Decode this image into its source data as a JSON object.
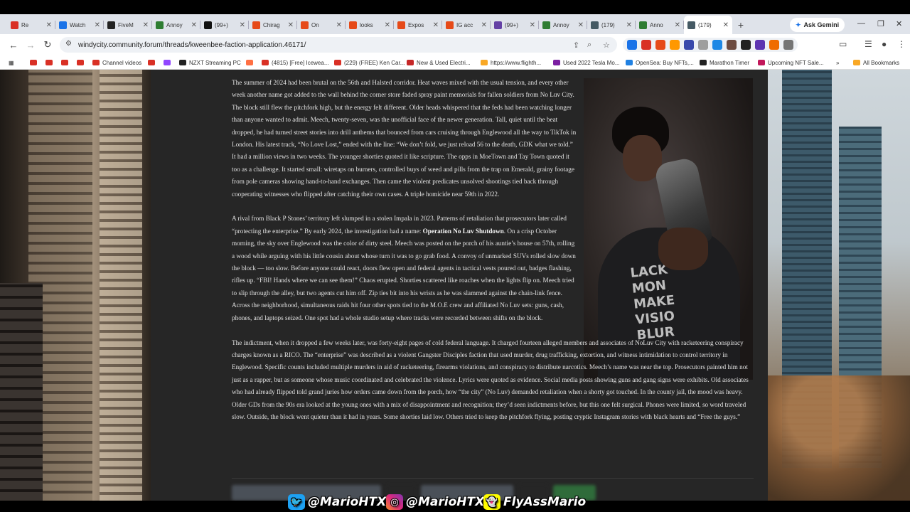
{
  "browser": {
    "tabs": [
      {
        "label": "Re",
        "color": "#d93025",
        "active": false
      },
      {
        "label": "Watch",
        "color": "#1a73e8",
        "active": false
      },
      {
        "label": "FiveM",
        "color": "#222222",
        "active": false
      },
      {
        "label": "Annoy",
        "color": "#2e7d32",
        "active": false
      },
      {
        "label": "(99+)",
        "color": "#111111",
        "active": false
      },
      {
        "label": "Chirag",
        "color": "#e64a19",
        "active": false
      },
      {
        "label": "On",
        "color": "#e64a19",
        "active": false
      },
      {
        "label": "looks",
        "color": "#e64a19",
        "active": false
      },
      {
        "label": "Expos",
        "color": "#e64a19",
        "active": false
      },
      {
        "label": "IG acc",
        "color": "#e64a19",
        "active": false
      },
      {
        "label": "(99+)",
        "color": "#6441a5",
        "active": false
      },
      {
        "label": "Annoy",
        "color": "#2e7d32",
        "active": false
      },
      {
        "label": "(179)",
        "color": "#455a64",
        "active": false
      },
      {
        "label": "Anno",
        "color": "#2e7d32",
        "active": false
      },
      {
        "label": "(179)",
        "color": "#455a64",
        "active": true
      }
    ],
    "new_tab_label": "+",
    "ask_gemini": "Ask Gemini",
    "url": "windycity.community.forum/threads/kweenbee-faction-application.46171/",
    "bookmarks": [
      {
        "label": "",
        "color": "#d93025"
      },
      {
        "label": "",
        "color": "#d93025"
      },
      {
        "label": "",
        "color": "#d93025"
      },
      {
        "label": "",
        "color": "#d93025"
      },
      {
        "label": "Channel videos",
        "color": "#d93025"
      },
      {
        "label": "",
        "color": "#d93025"
      },
      {
        "label": "",
        "color": "#9146ff"
      },
      {
        "label": "NZXT Streaming PC",
        "color": "#222222"
      },
      {
        "label": "",
        "color": "#ff7043"
      },
      {
        "label": "(4815) [Free] Icewea...",
        "color": "#d93025"
      },
      {
        "label": "(229) (FREE) Ken Car...",
        "color": "#d93025"
      },
      {
        "label": "New & Used Electri...",
        "color": "#c62828"
      },
      {
        "label": "https://www.flighth...",
        "color": "#f9a825"
      },
      {
        "label": "Used 2022 Tesla Mo...",
        "color": "#7b1fa2"
      },
      {
        "label": "OpenSea: Buy NFTs,...",
        "color": "#2081e2"
      },
      {
        "label": "Marathon Timer",
        "color": "#222222"
      },
      {
        "label": "Upcoming NFT Sale...",
        "color": "#c2185b"
      }
    ],
    "all_bookmarks": "All Bookmarks"
  },
  "post": {
    "paragraphs": [
      {
        "text": "The summer of 2024 had been brutal on the 56th and Halsted corridor. Heat waves mixed with the usual tension, and every other week another name got added to the wall behind the corner store faded spray paint memorials for fallen soldiers from No Luv City. The block still flew the pitchfork high, but the energy felt different. Older heads whispered that the feds had been watching longer than anyone wanted to admit. Meech, twenty-seven, was the unofficial face of the newer generation. Tall, quiet until the beat dropped, he had turned street stories into drill anthems that bounced from cars cruising through Englewood all the way to TikTok in London. His latest track, “No Love Lost,” ended with the line: “We don’t fold, we just reload 56 to the death, GDK what we told.” It had a million views in two weeks. The younger shorties quoted it like scripture. The opps in MoeTown and Tay Town quoted it too as a challenge. It started small: wiretaps on burners, controlled buys of weed and pills from the trap on Emerald, grainy footage from pole cameras showing hand-to-hand exchanges. Then came the violent predicates unsolved shootings tied back through cooperating witnesses who flipped after catching their own cases. A triple homicide near 59th in 2022."
      },
      {
        "before": "A rival from Black P Stones’ territory left slumped in a stolen Impala in 2023. Patterns of retaliation that prosecutors later called “protecting the enterprise.” By early 2024, the investigation had a name: ",
        "bold": "Operation No Luv Shutdown",
        "after": ". On a crisp October morning, the sky over Englewood was the color of dirty steel. Meech was posted on the porch of his auntie’s house on 57th, rolling a wood while arguing with his little cousin about whose turn it was to go grab food. A convoy of unmarked SUVs rolled slow down the block — too slow. Before anyone could react, doors flew open and federal agents in tactical vests poured out, badges flashing, rifles up. “FBI! Hands where we can see them!” Chaos erupted. Shorties scattered like roaches when the lights flip on. Meech tried to slip through the alley, but two agents cut him off. Zip ties bit into his wrists as he was slammed against the chain-link fence. Across the neighborhood, simultaneous raids hit four other spots tied to the M.O.E crew and affiliated No Luv sets: guns, cash, phones, and laptops seized. One spot had a whole studio setup where tracks were recorded between shifts on the block."
      },
      {
        "text": "The indictment, when it dropped a few weeks later, was forty-eight pages of cold federal language. It charged fourteen alleged members and associates of NoLuv City with racketeering conspiracy charges known as a RICO. The “enterprise” was described as a violent Gangster Disciples faction that used murder, drug trafficking, extortion, and witness intimidation to control territory in Englewood. Specific counts included multiple murders in aid of racketeering, firearms violations, and conspiracy to distribute narcotics. Meech’s name was near the top. Prosecutors painted him not just as a rapper, but as someone whose music coordinated and celebrated the violence. Lyrics were quoted as evidence. Social media posts showing guns and gang signs were exhibits. Old associates who had already flipped told grand juries how orders came down from the porch, how “the city” (No Luv) demanded retaliation when a shorty got touched. In the county jail, the mood was heavy. Older GDs from the 90s era looked at the young ones with a mix of disappointment and recognition; they’d seen indictments before, but this one felt surgical. Phones were limited, so word traveled slow. Outside, the block went quieter than it had in years. Some shorties laid low. Others tried to keep the pitchfork flying, posting cryptic Instagram stories with black hearts and “Free the guys.”"
      }
    ],
    "photo_shirt_text": "LACK\nMON\nMAKE\nVISIO\nBLUR"
  },
  "overlay": {
    "twitter": "@MarioHTXX",
    "instagram": "@MarioHTXX",
    "snapchat": "FlyAssMario"
  }
}
